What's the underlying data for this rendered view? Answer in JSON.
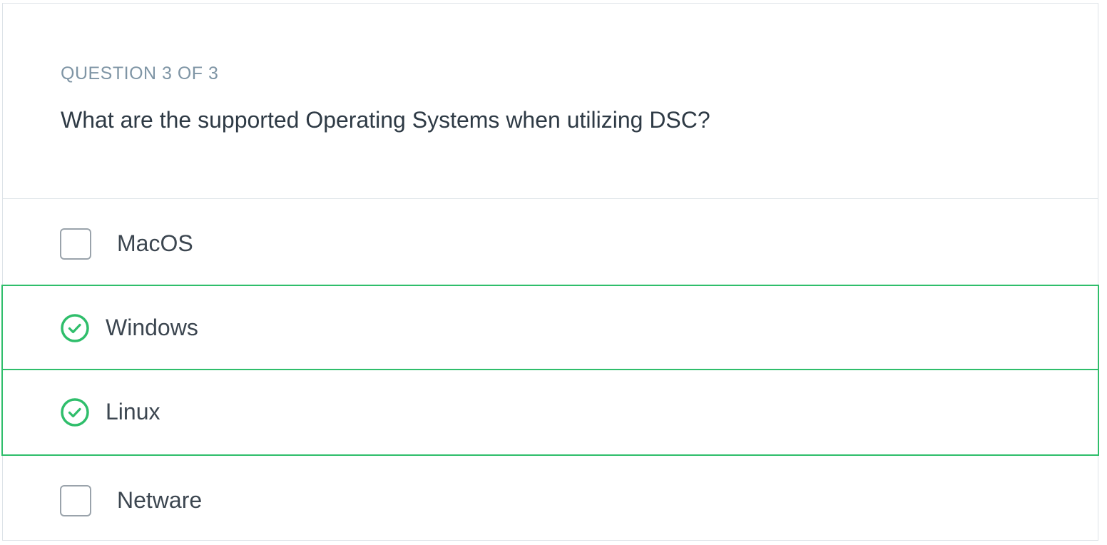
{
  "question": {
    "counter": "QUESTION 3 OF 3",
    "text": "What are the supported Operating Systems when utilizing DSC?"
  },
  "answers": [
    {
      "label": "MacOS",
      "state": "unselected"
    },
    {
      "label": "Windows",
      "state": "correct"
    },
    {
      "label": "Linux",
      "state": "correct"
    },
    {
      "label": "Netware",
      "state": "unselected"
    }
  ],
  "colors": {
    "correct": "#2fbe6b",
    "counter": "#7f95a5",
    "question_text": "#2e3a45",
    "border": "#dde3e8"
  },
  "icons": {
    "correct": "check-circle-icon",
    "unselected": "checkbox-icon"
  }
}
